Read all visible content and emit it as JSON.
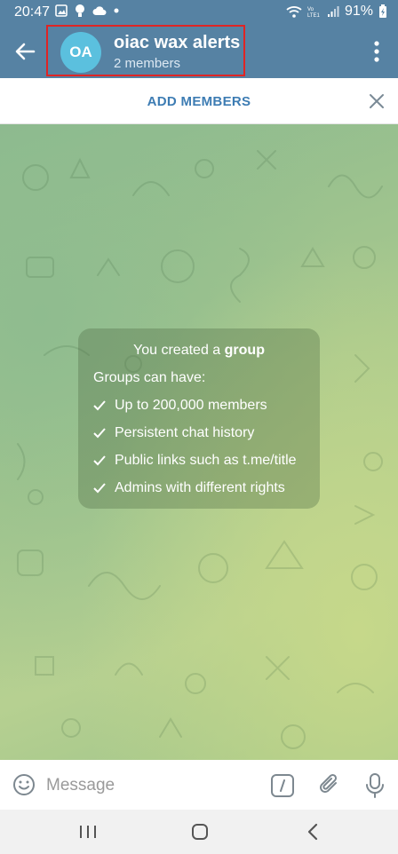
{
  "status_bar": {
    "time": "20:47",
    "battery": "91%",
    "left_icons": [
      "gallery-icon",
      "lightbulb-icon",
      "cloud-icon",
      "dot-icon"
    ],
    "right_icons": [
      "wifi-icon",
      "volte-icon",
      "signal-icon",
      "battery-icon"
    ]
  },
  "header": {
    "avatar_initials": "OA",
    "avatar_color": "#5bc0de",
    "title": "oiac wax alerts",
    "subtitle": "2 members",
    "bar_color": "#5682a3"
  },
  "add_members_bar": {
    "label": "ADD MEMBERS"
  },
  "info_card": {
    "title_prefix": "You created a ",
    "title_bold": "group",
    "subtitle": "Groups can have:",
    "features": [
      "Up to 200,000 members",
      "Persistent chat history",
      "Public links such as t.me/title",
      "Admins with different rights"
    ]
  },
  "composer": {
    "placeholder": "Message"
  },
  "colors": {
    "accent": "#3d7cb3",
    "highlight_border": "#e02424"
  }
}
